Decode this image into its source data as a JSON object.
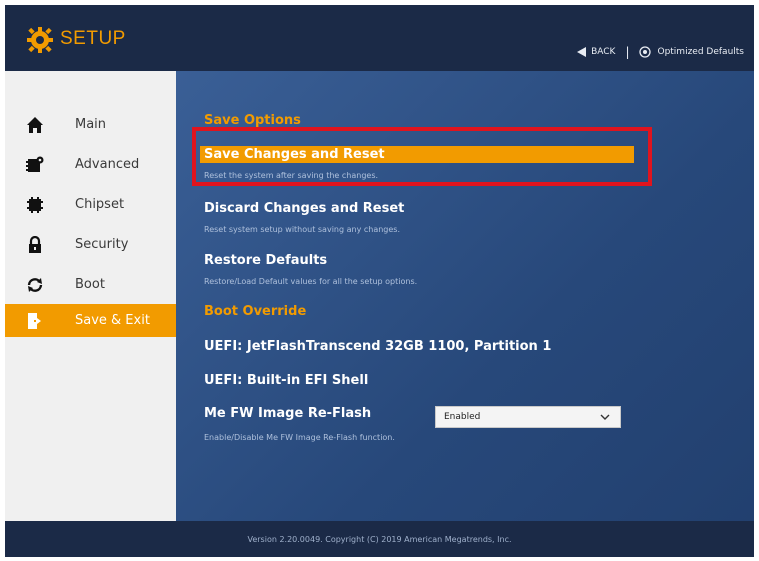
{
  "header": {
    "title": "SETUP",
    "back_label": "BACK",
    "separator": "|",
    "optimized_defaults_label": "Optimized Defaults"
  },
  "sidebar": {
    "items": [
      {
        "label": "Main",
        "icon": "home-icon"
      },
      {
        "label": "Advanced",
        "icon": "chip-gear-icon"
      },
      {
        "label": "Chipset",
        "icon": "chip-icon"
      },
      {
        "label": "Security",
        "icon": "lock-icon"
      },
      {
        "label": "Boot",
        "icon": "reboot-icon"
      },
      {
        "label": "Save & Exit",
        "icon": "exit-door-icon",
        "active": true
      }
    ]
  },
  "main": {
    "save_options_title": "Save Options",
    "save_reset": {
      "label": "Save Changes and Reset",
      "desc": "Reset the system after saving the changes."
    },
    "discard_reset": {
      "label": "Discard Changes and Reset",
      "desc": "Reset system setup without saving any changes."
    },
    "restore_defaults": {
      "label": "Restore Defaults",
      "desc": "Restore/Load Default values for all the setup options."
    },
    "boot_override_title": "Boot Override",
    "boot_items": [
      "UEFI: JetFlashTranscend 32GB 1100, Partition 1",
      "UEFI: Built-in EFI Shell"
    ],
    "me_fw": {
      "label": "Me FW Image Re-Flash",
      "value": "Enabled",
      "desc": "Enable/Disable Me FW Image Re-Flash function."
    }
  },
  "footer": {
    "text": "Version 2.20.0049. Copyright (C) 2019 American Megatrends, Inc."
  },
  "colors": {
    "accent": "#f29b00",
    "header_bg": "#1b2a47",
    "panel_bg": "#2d4f85",
    "highlight_box": "#e0141e"
  }
}
